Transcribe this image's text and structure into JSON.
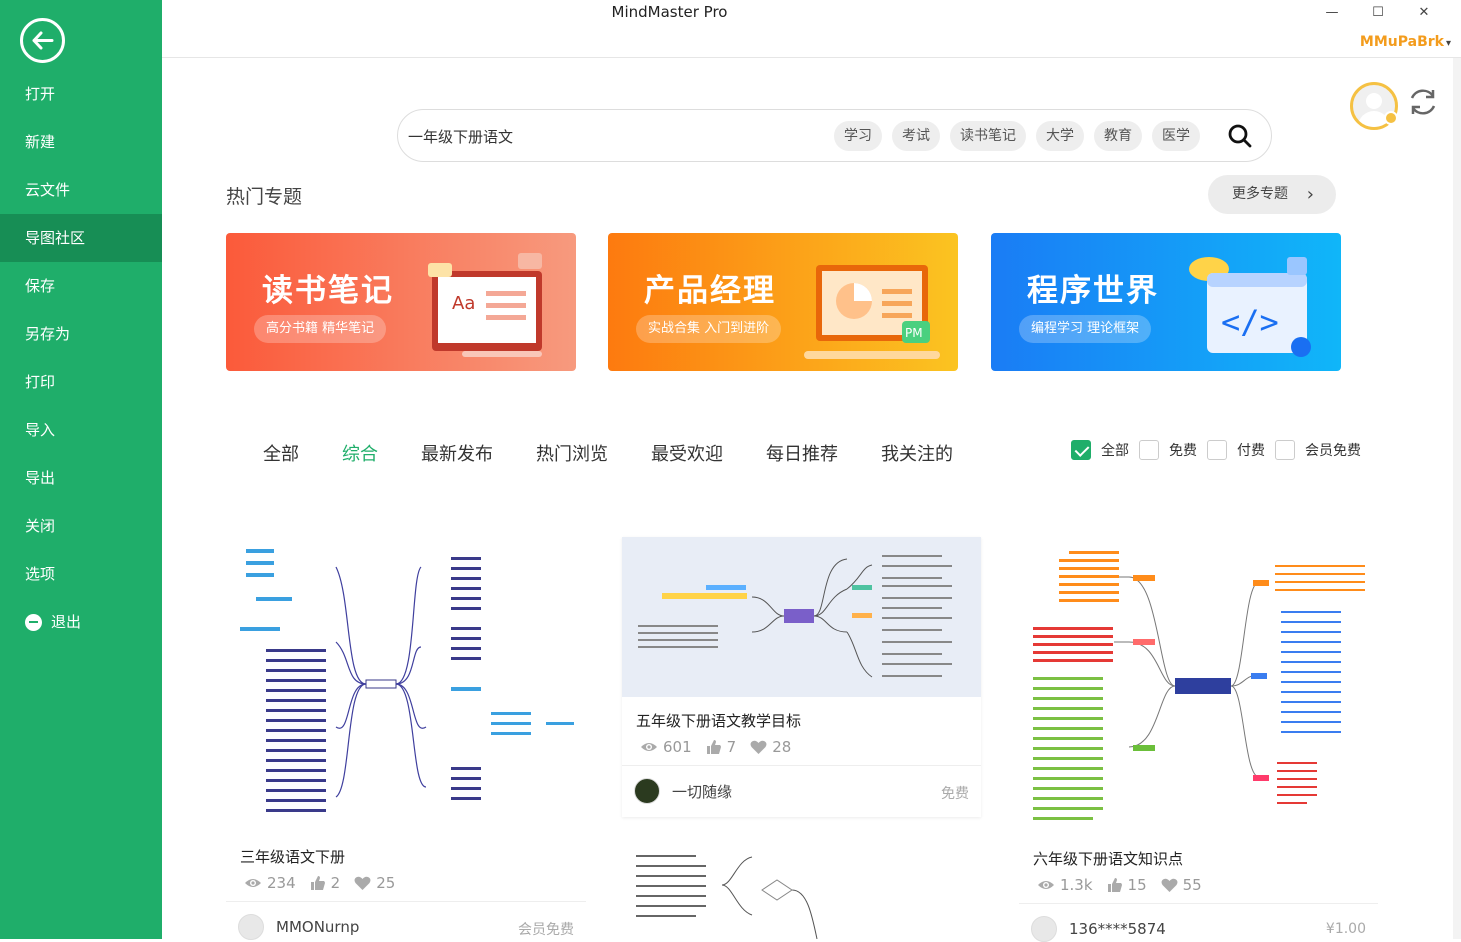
{
  "app": {
    "title": "MindMaster Pro",
    "user_name": "MMuPaBrk"
  },
  "window_controls": {
    "minimize": "—",
    "maximize": "☐",
    "close": "✕"
  },
  "sidebar": {
    "items": [
      {
        "label": "打开"
      },
      {
        "label": "新建"
      },
      {
        "label": "云文件"
      },
      {
        "label": "导图社区",
        "active": true
      },
      {
        "label": "保存"
      },
      {
        "label": "另存为"
      },
      {
        "label": "打印"
      },
      {
        "label": "导入"
      },
      {
        "label": "导出"
      },
      {
        "label": "关闭"
      },
      {
        "label": "选项"
      },
      {
        "label": "退出"
      }
    ]
  },
  "search": {
    "value": "一年级下册语文",
    "tags": [
      "学习",
      "考试",
      "读书笔记",
      "大学",
      "教育",
      "医学"
    ]
  },
  "hot_topics": {
    "title": "热门专题",
    "more_label": "更多专题",
    "banners": [
      {
        "title": "读书笔记",
        "subtitle": "高分书籍 精华笔记"
      },
      {
        "title": "产品经理",
        "subtitle": "实战合集 入门到进阶"
      },
      {
        "title": "程序世界",
        "subtitle": "编程学习 理论框架"
      }
    ]
  },
  "tabs": [
    "全部",
    "综合",
    "最新发布",
    "热门浏览",
    "最受欢迎",
    "每日推荐",
    "我关注的"
  ],
  "active_tab": "综合",
  "filters": [
    {
      "label": "全部",
      "checked": true
    },
    {
      "label": "免费",
      "checked": false
    },
    {
      "label": "付费",
      "checked": false
    },
    {
      "label": "会员免费",
      "checked": false
    }
  ],
  "cards": [
    {
      "title": "三年级语文下册",
      "views": "234",
      "likes": "2",
      "favorites": "25",
      "author": "MMONurnp",
      "price": "会员免费"
    },
    {
      "title": "五年级下册语文教学目标",
      "views": "601",
      "likes": "7",
      "favorites": "28",
      "author": "一切随缘",
      "price": "免费"
    },
    {
      "title": "六年级下册语文知识点",
      "views": "1.3k",
      "likes": "15",
      "favorites": "55",
      "author": "136****5874",
      "price": "¥1.00"
    }
  ],
  "colors": {
    "brand": "#1fae6a",
    "accent": "#f39c1d"
  }
}
